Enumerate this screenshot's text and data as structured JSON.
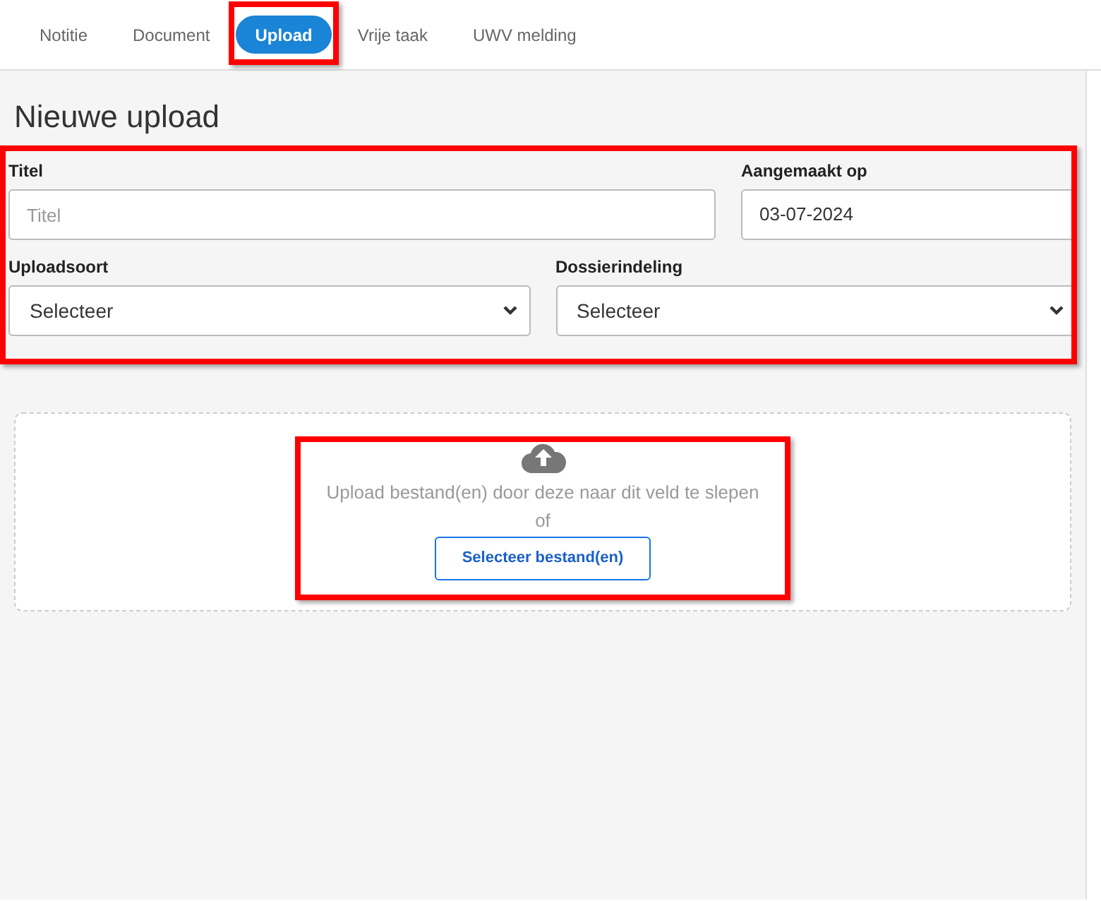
{
  "tabs": [
    {
      "label": "Notitie",
      "selected": false,
      "highlighted": false
    },
    {
      "label": "Document",
      "selected": false,
      "highlighted": false
    },
    {
      "label": "Upload",
      "selected": true,
      "highlighted": true
    },
    {
      "label": "Vrije taak",
      "selected": false,
      "highlighted": false
    },
    {
      "label": "UWV melding",
      "selected": false,
      "highlighted": false
    }
  ],
  "heading": "Nieuwe upload",
  "form": {
    "highlighted": true,
    "title_field": {
      "label": "Titel",
      "placeholder": "Titel"
    },
    "date_field": {
      "label": "Aangemaakt op",
      "value": "03-07-2024"
    },
    "upload_type": {
      "label": "Uploadsoort",
      "value": "Selecteer"
    },
    "file_category": {
      "label": "Dossierindeling",
      "value": "Selecteer"
    }
  },
  "dropzone": {
    "highlighted": true,
    "text": "Upload bestand(en) door deze naar dit veld te slepen",
    "or": "of",
    "button": "Selecteer bestand(en)"
  }
}
